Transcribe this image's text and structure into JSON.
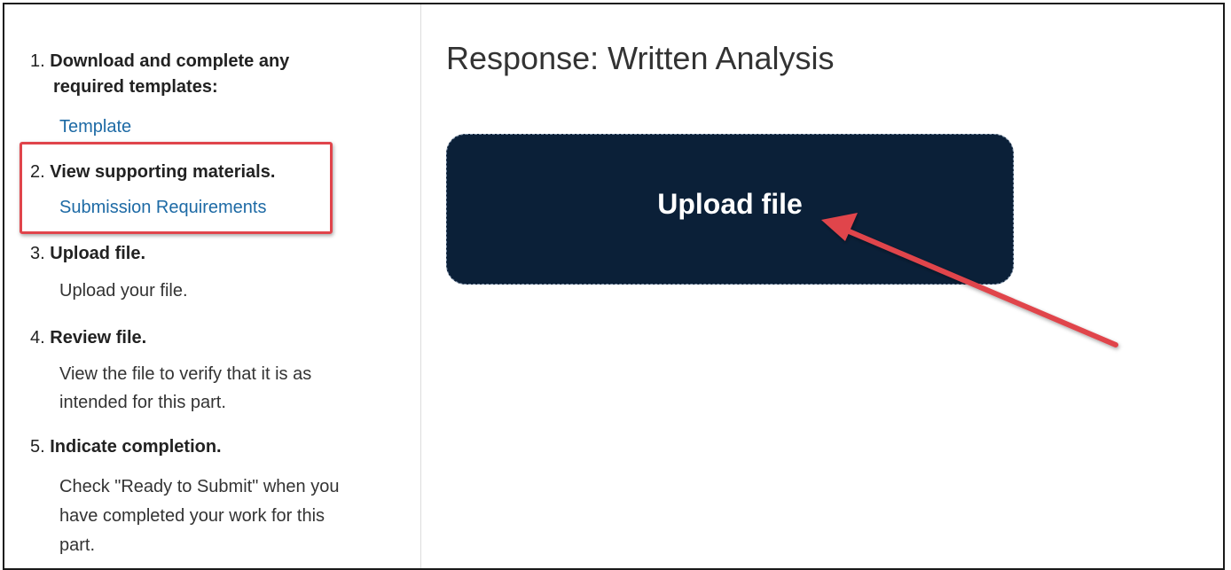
{
  "sidebar": {
    "steps": [
      {
        "number": "1.",
        "title": "Download and complete any",
        "title2": "required templates:",
        "link": "Template"
      },
      {
        "number": "2.",
        "title": "View supporting materials.",
        "link": "Submission Requirements"
      },
      {
        "number": "3.",
        "title": "Upload file.",
        "description": "Upload your file."
      },
      {
        "number": "4.",
        "title": "Review file.",
        "description": "View the file to verify that it is as",
        "description2": "intended for this part."
      },
      {
        "number": "5.",
        "title": "Indicate completion.",
        "description": "Check \"Ready to Submit\" when you",
        "description2": "have completed your work for this",
        "description3": "part."
      }
    ]
  },
  "main": {
    "title": "Response: Written Analysis",
    "upload_label": "Upload file"
  },
  "colors": {
    "link": "#1d6aa5",
    "upload_bg": "#0b2038",
    "annotation": "#e0444b"
  }
}
